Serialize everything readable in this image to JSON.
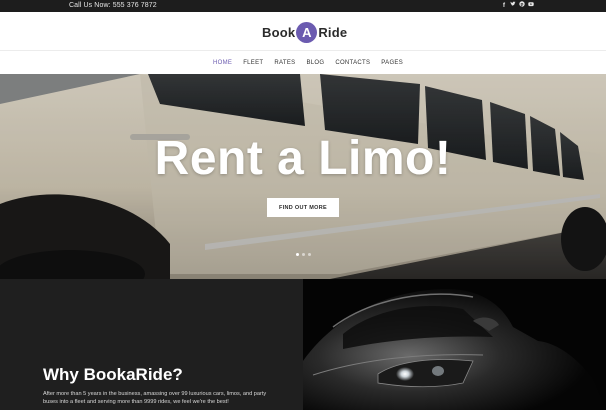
{
  "topbar": {
    "phone": "Call Us Now: 555 376 7872",
    "social": [
      "facebook-icon",
      "twitter-icon",
      "pinterest-icon",
      "youtube-icon"
    ]
  },
  "brand": {
    "part1": "Book",
    "badge": "A",
    "part2": "Ride",
    "accent": "#6b5bb0"
  },
  "nav": {
    "items": [
      "HOME",
      "FLEET",
      "RATES",
      "BLOG",
      "CONTACTS",
      "PAGES"
    ],
    "active": "HOME"
  },
  "hero": {
    "title": "Rent a Limo!",
    "cta": "FIND OUT MORE",
    "slides": 3,
    "current_slide": 1
  },
  "why": {
    "title": "Why BookaRide?",
    "text": "After more than 5 years in the business, amassing over 99 luxurious cars, limos, and party buses into a fleet and serving more than 9999 rides, we feel we're the best!"
  }
}
